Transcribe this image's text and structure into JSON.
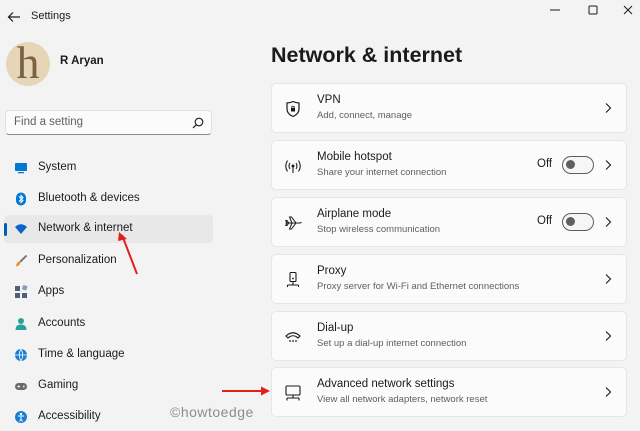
{
  "window": {
    "title": "Settings",
    "controls": [
      "minimize",
      "maximize",
      "close"
    ]
  },
  "profile": {
    "name": "R Aryan",
    "avatar_letter": "h"
  },
  "search": {
    "placeholder": "Find a setting"
  },
  "sidebar": {
    "items": [
      {
        "label": "System",
        "icon": "system-icon",
        "color": "#0078d4"
      },
      {
        "label": "Bluetooth & devices",
        "icon": "bluetooth-icon",
        "color": "#0078d4"
      },
      {
        "label": "Network & internet",
        "icon": "wifi-icon",
        "color": "#005fb8",
        "active": true
      },
      {
        "label": "Personalization",
        "icon": "brush-icon",
        "color": "#e8912d"
      },
      {
        "label": "Apps",
        "icon": "apps-icon",
        "color": "#50607a"
      },
      {
        "label": "Accounts",
        "icon": "accounts-icon",
        "color": "#2aa198"
      },
      {
        "label": "Time & language",
        "icon": "globe-icon",
        "color": "#1a7fd4"
      },
      {
        "label": "Gaming",
        "icon": "gamepad-icon",
        "color": "#6b6b6b"
      },
      {
        "label": "Accessibility",
        "icon": "accessibility-icon",
        "color": "#1a7fd4"
      }
    ]
  },
  "main": {
    "title": "Network & internet",
    "cards": [
      {
        "title": "VPN",
        "subtitle": "Add, connect, manage",
        "icon": "shield-icon"
      },
      {
        "title": "Mobile hotspot",
        "subtitle": "Share your internet connection",
        "icon": "hotspot-icon",
        "toggle": "Off"
      },
      {
        "title": "Airplane mode",
        "subtitle": "Stop wireless communication",
        "icon": "airplane-icon",
        "toggle": "Off"
      },
      {
        "title": "Proxy",
        "subtitle": "Proxy server for Wi-Fi and Ethernet connections",
        "icon": "proxy-icon"
      },
      {
        "title": "Dial-up",
        "subtitle": "Set up a dial-up internet connection",
        "icon": "dialup-icon"
      },
      {
        "title": "Advanced network settings",
        "subtitle": "View all network adapters, network reset",
        "icon": "monitor-network-icon"
      }
    ]
  },
  "watermark": "©howtoedge",
  "colors": {
    "accent": "#005fb8",
    "annotation_arrow": "#e0201b"
  }
}
